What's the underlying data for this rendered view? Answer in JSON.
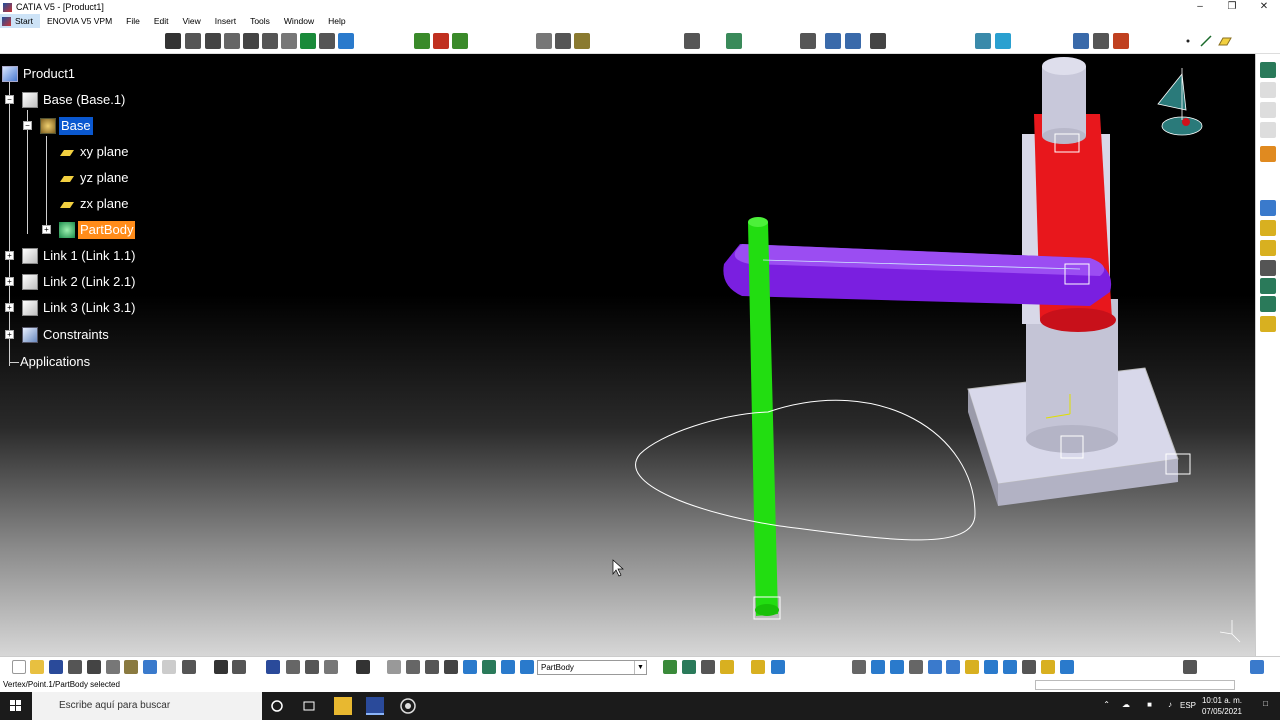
{
  "window": {
    "title": "CATIA V5 - [Product1]"
  },
  "menu": {
    "start": "Start",
    "items": [
      "ENOVIA V5 VPM",
      "File",
      "Edit",
      "View",
      "Insert",
      "Tools",
      "Window",
      "Help"
    ]
  },
  "tree": {
    "root": "Product1",
    "base_instance": "Base (Base.1)",
    "base_part": "Base",
    "planes": [
      "xy plane",
      "yz plane",
      "zx plane"
    ],
    "part_body": "PartBody",
    "links": [
      "Link 1 (Link 1.1)",
      "Link 2 (Link 2.1)",
      "Link 3 (Link 3.1)"
    ],
    "constraints": "Constraints",
    "applications": "Applications"
  },
  "bottom_toolbar": {
    "active_body": "PartBody"
  },
  "status": {
    "message": "Vertex/Point.1/PartBody selected"
  },
  "taskbar": {
    "search_placeholder": "Escribe aquí para buscar",
    "language": "ESP",
    "time": "10:01 a. m.",
    "date": "07/05/2021"
  },
  "colors": {
    "selection_blue": "#0a58d0",
    "active_orange": "#ff8c1a",
    "link_green": "#22dd11",
    "link_purple": "#7a1fe0",
    "link_red": "#e8171c",
    "base_gray": "#c8c8d8"
  }
}
